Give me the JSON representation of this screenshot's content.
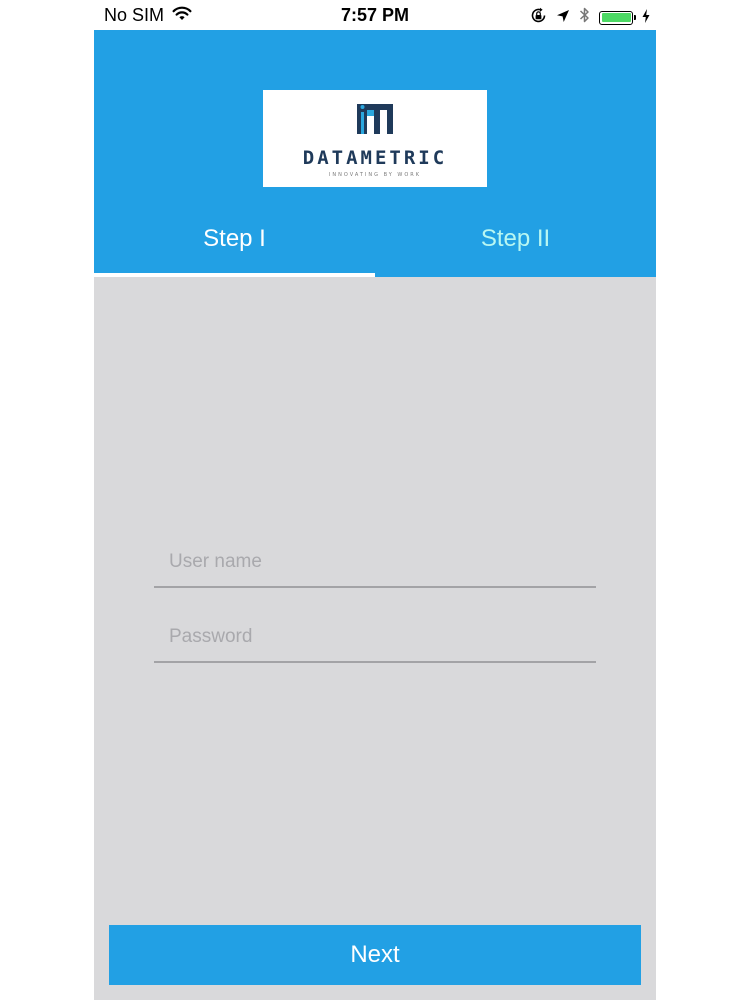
{
  "status_bar": {
    "carrier": "No SIM",
    "time": "7:57 PM",
    "icons": [
      "wifi-icon",
      "orientation-lock-icon",
      "location-arrow-icon",
      "bluetooth-icon",
      "battery-icon",
      "charging-bolt-icon"
    ],
    "battery_level": 1.0
  },
  "header": {
    "logo": {
      "wordmark": "DATAMETRIC",
      "tagline": "INNOVATING BY WORK"
    },
    "tabs": [
      {
        "label": "Step I",
        "active": true
      },
      {
        "label": "Step II",
        "active": false
      }
    ]
  },
  "form": {
    "username": {
      "placeholder": "User name",
      "value": ""
    },
    "password": {
      "placeholder": "Password",
      "value": ""
    }
  },
  "footer": {
    "next_label": "Next"
  },
  "colors": {
    "primary": "#22a0e4",
    "background": "#d9d9db",
    "inactive_tab": "#b8f7f2",
    "underline": "#a3a3a6",
    "battery": "#4cd964"
  }
}
